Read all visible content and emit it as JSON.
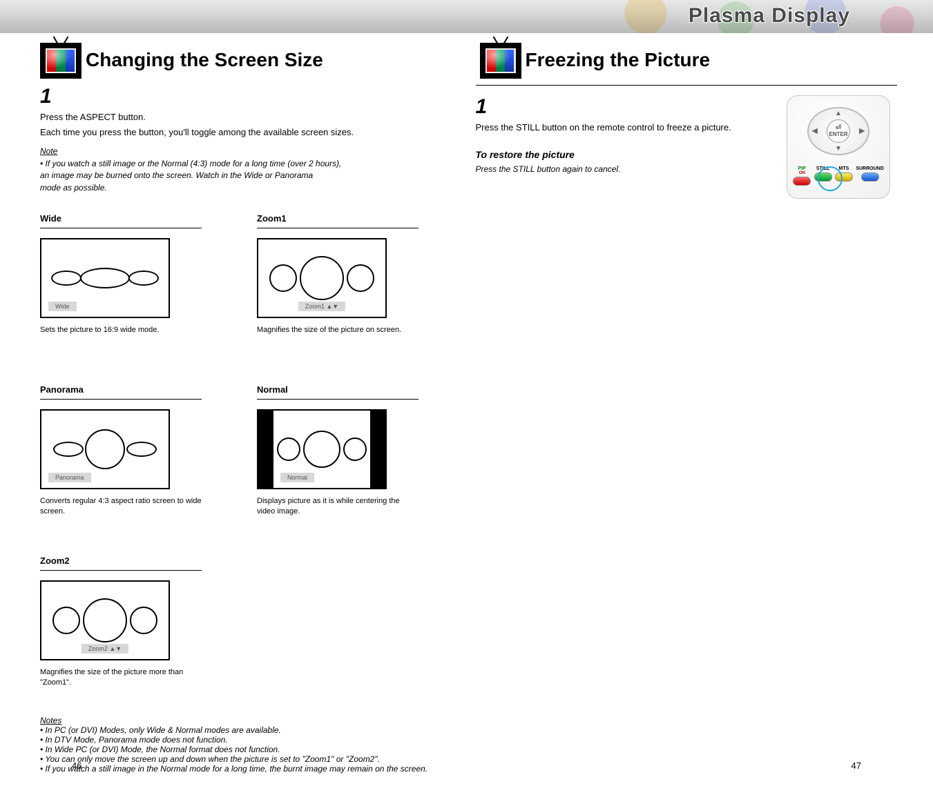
{
  "brand": "Plasma Display",
  "left": {
    "title": "Changing the Screen Size",
    "step1_num": "1",
    "step1_line1": "Press the ASPECT button.",
    "step1_line2": "Each time you press the button, you'll toggle among the available screen sizes.",
    "note_head": "Note",
    "note_line1": "• If you watch a still image or the Normal (4:3) mode for a long time (over 2 hours),",
    "note_line2": "an image may be burned onto the screen. Watch in the Wide or Panorama",
    "note_line3": "mode as possible.",
    "modes": {
      "wide": {
        "label": "Wide",
        "tag": "Wide",
        "caption": "Sets the picture to 16:9 wide mode."
      },
      "zoom1": {
        "label": "Zoom1",
        "tag": "Zoom1  ▲▼",
        "caption": "Magnifies the size of the picture on screen."
      },
      "panorama": {
        "label": "Panorama",
        "tag": "Panorama",
        "caption": "Converts regular 4:3 aspect ratio screen to wide screen."
      },
      "normal": {
        "label": "Normal",
        "tag": "Normal",
        "caption": "Displays picture as it is while centering the video image."
      },
      "zoom2": {
        "label": "Zoom2",
        "tag": "Zoom2  ▲▼",
        "caption": "Magnifies the size of the picture more than \"Zoom1\"."
      }
    },
    "notes_bottom_head": "Notes",
    "notes_bottom_1": "• In PC (or DVI) Modes, only Wide & Normal modes are available.",
    "notes_bottom_2": "• In DTV Mode, Panorama mode does not function.",
    "notes_bottom_3": "• In Wide PC (or DVI) Mode, the Normal format does not function.",
    "notes_bottom_4": "• You can only move the screen up and down when the picture is set to \"Zoom1\" or \"Zoom2\".",
    "notes_bottom_5": "• If you watch a still image in the Normal mode for a long time, the burnt image may remain on the screen."
  },
  "right": {
    "title": "Freezing the Picture",
    "step1_num": "1",
    "step1_text": "Press the STILL button on the remote control to freeze a picture.",
    "restore_head": "To restore the picture",
    "restore_text": "Press the STILL button again to cancel.",
    "remote": {
      "enter": "ENTER",
      "pip": "PIP",
      "on": "ON",
      "still": "STILL",
      "mts": "MTS",
      "surround": "SURROUND"
    }
  },
  "pages": {
    "left": "46",
    "right": "47"
  }
}
